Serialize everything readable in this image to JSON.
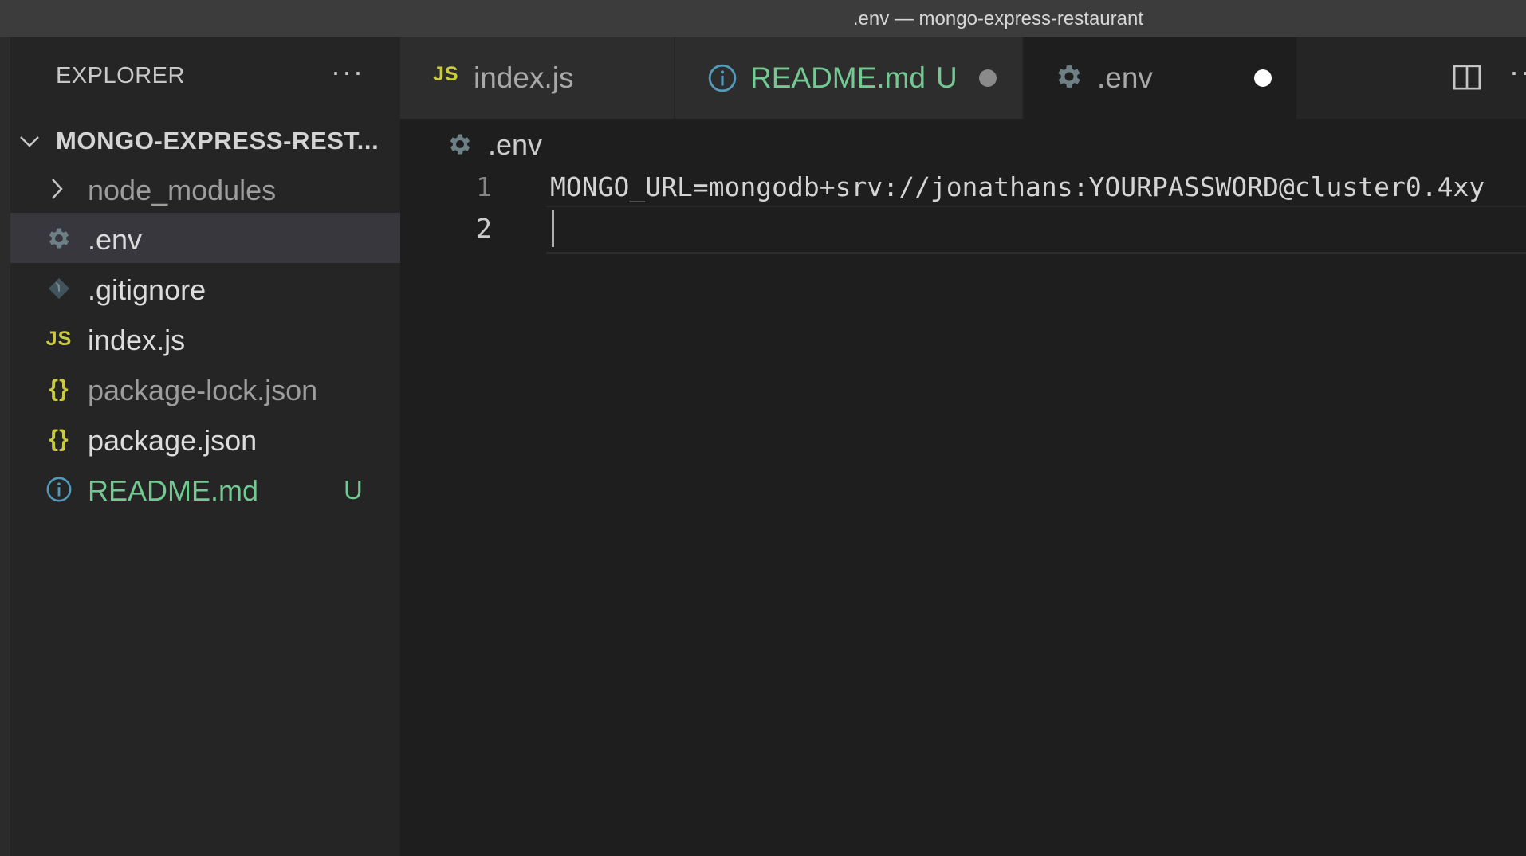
{
  "window": {
    "title": ".env — mongo-express-restaurant"
  },
  "sidebar": {
    "header": "EXPLORER",
    "more_label": "···",
    "folder": {
      "name": "MONGO-EXPRESS-REST..."
    },
    "items": [
      {
        "label": "node_modules",
        "icon": "chevron-right-icon",
        "kind": "folder"
      },
      {
        "label": ".env",
        "icon": "gear-icon",
        "selected": true
      },
      {
        "label": ".gitignore",
        "icon": "git-icon"
      },
      {
        "label": "index.js",
        "icon": "js-icon",
        "icon_text": "JS"
      },
      {
        "label": "package-lock.json",
        "icon": "braces-icon",
        "icon_text": "{}"
      },
      {
        "label": "package.json",
        "icon": "braces-icon",
        "icon_text": "{}"
      },
      {
        "label": "README.md",
        "icon": "info-icon",
        "badge": "U"
      }
    ]
  },
  "tabs": [
    {
      "label": "index.js",
      "icon": "js-icon",
      "icon_text": "JS",
      "active": false
    },
    {
      "label": "README.md",
      "icon": "info-icon",
      "badge": "U",
      "modified": true,
      "active": false
    },
    {
      "label": ".env",
      "icon": "gear-icon",
      "modified": true,
      "active": true
    }
  ],
  "tab_actions": {
    "more_label": "··"
  },
  "breadcrumb": {
    "file": ".env",
    "icon": "gear-icon"
  },
  "editor": {
    "lines": [
      {
        "number": "1",
        "text": "MONGO_URL=mongodb+srv://jonathans:YOURPASSWORD@cluster0.4xy"
      },
      {
        "number": "2",
        "text": ""
      }
    ],
    "current_line": 2
  },
  "colors": {
    "accent_yellow": "#cbcb41",
    "git_untracked": "#73c991",
    "info_blue": "#519aba",
    "gear_gray": "#6d8086"
  }
}
